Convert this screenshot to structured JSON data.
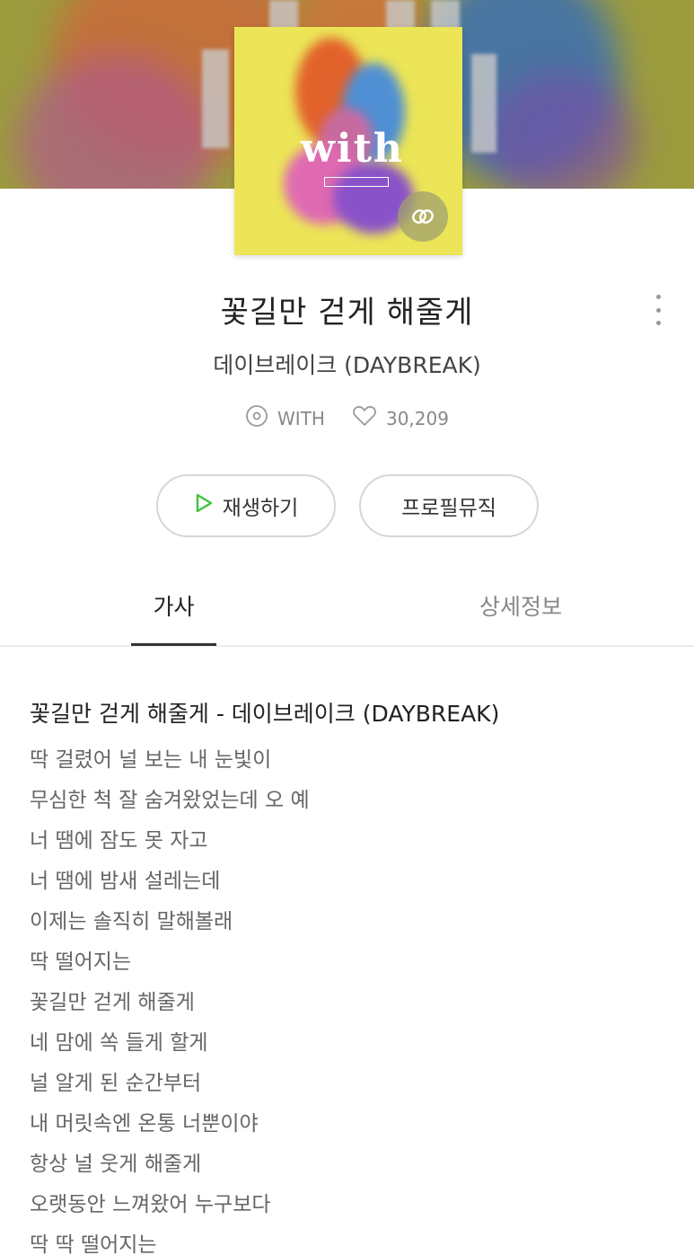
{
  "album": {
    "art_title": "with",
    "art_artist": "DAYBREAK"
  },
  "song": {
    "title": "꽃길만 걷게 해줄게",
    "artist": "데이브레이크 (DAYBREAK)",
    "album_name": "WITH",
    "like_count": "30,209"
  },
  "icons": {
    "album": "disc-icon",
    "like": "heart-icon",
    "play": "play-icon",
    "more": "more-vertical-icon",
    "badge": "link-badge-icon"
  },
  "actions": {
    "play_label": "재생하기",
    "profile_music_label": "프로필뮤직"
  },
  "tabs": [
    {
      "label": "가사",
      "active": true
    },
    {
      "label": "상세정보",
      "active": false
    }
  ],
  "lyrics": {
    "heading": "꽃길만 걷게 해줄게 - 데이브레이크 (DAYBREAK)",
    "lines": [
      "딱 걸렸어 널 보는 내 눈빛이",
      "무심한 척 잘 숨겨왔었는데 오 예",
      "너 땜에 잠도 못 자고",
      "너 땜에 밤새 설레는데",
      "이제는 솔직히 말해볼래",
      "딱 떨어지는",
      "꽃길만 걷게 해줄게",
      "네 맘에 쏙 들게 할게",
      "널 알게 된 순간부터",
      "내 머릿속엔 온통 너뿐이야",
      "항상 널 웃게 해줄게",
      "오랫동안 느껴왔어 누구보다",
      "딱 딱 떨어지는"
    ]
  },
  "colors": {
    "play_accent": "#3ec43e",
    "album_background": "#ece557"
  }
}
